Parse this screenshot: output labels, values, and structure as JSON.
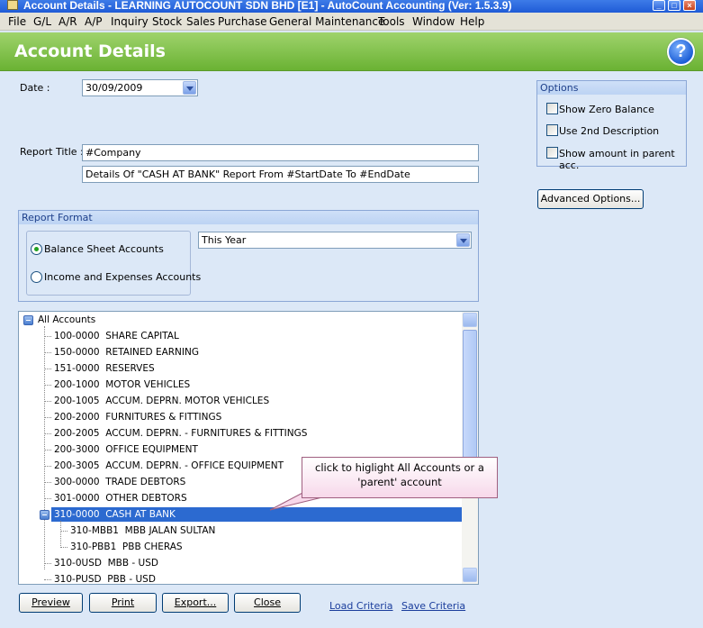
{
  "window": {
    "title": "Account Details - LEARNING AUTOCOUNT SDN BHD [E1] - AutoCount Accounting (Ver: 1.5.3.9)"
  },
  "menu": [
    "File",
    "G/L",
    "A/R",
    "A/P",
    "Inquiry",
    "Stock",
    "Sales",
    "Purchase",
    "General Maintenance",
    "Tools",
    "Window",
    "Help"
  ],
  "banner": {
    "title": "Account Details",
    "help": "?"
  },
  "form": {
    "date_label": "Date :",
    "date_value": "30/09/2009",
    "report_title_label": "Report Title :",
    "report_title_1": "#Company",
    "report_title_2": "Details Of \"CASH AT BANK\" Report From #StartDate To #EndDate"
  },
  "options": {
    "header": "Options",
    "show_zero_balance": "Show Zero Balance",
    "use_2nd_description": "Use 2nd Description",
    "show_amount_parent": "Show amount in parent acc.",
    "advanced_button": "Advanced Options..."
  },
  "report_format": {
    "header": "Report Format",
    "balance_sheet": "Balance Sheet Accounts",
    "income_expenses": "Income and Expenses Accounts",
    "period": "This Year",
    "selected": "Balance Sheet Accounts"
  },
  "tree": {
    "root": "All Accounts",
    "items": [
      "100-0000  SHARE CAPITAL",
      "150-0000  RETAINED EARNING",
      "151-0000  RESERVES",
      "200-1000  MOTOR VEHICLES",
      "200-1005  ACCUM. DEPRN. MOTOR VEHICLES",
      "200-2000  FURNITURES & FITTINGS",
      "200-2005  ACCUM. DEPRN. - FURNITURES & FITTINGS",
      "200-3000  OFFICE EQUIPMENT",
      "200-3005  ACCUM. DEPRN. - OFFICE EQUIPMENT",
      "300-0000  TRADE DEBTORS",
      "301-0000  OTHER DEBTORS",
      "310-0000  CASH AT BANK",
      "310-MBB1  MBB JALAN SULTAN",
      "310-PBB1  PBB CHERAS",
      "310-0USD  MBB - USD",
      "310-PUSD  PBB - USD"
    ],
    "selected": "310-0000  CASH AT BANK"
  },
  "callout": "click to higlight All Accounts or a 'parent' account",
  "buttons": {
    "preview": "Preview",
    "print": "Print",
    "export": "Export...",
    "close": "Close"
  },
  "links": {
    "load_criteria": "Load Criteria",
    "save_criteria": "Save Criteria"
  }
}
